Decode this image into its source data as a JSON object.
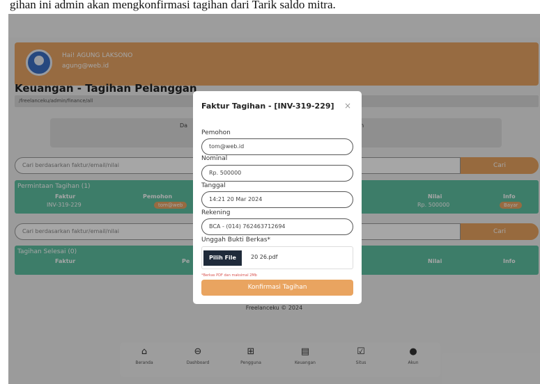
{
  "caption": "gihan ini admin akan mengkonfirmasi tagihan dari Tarik saldo mitra.",
  "profile": {
    "greeting": "Hai! AGUNG LAKSONO",
    "email": "agung@web.id"
  },
  "page": {
    "title": "Keuangan - Tagihan Pelanggan",
    "breadcrumb": "/freelanceku/admin/finance/all"
  },
  "stats": {
    "left_label": "Da",
    "right_label": "un"
  },
  "search": {
    "placeholder": "Cari berdasarkan faktur/email/nilai",
    "button": "Cari"
  },
  "requests": {
    "title": "Permintaan Tagihan (1)",
    "columns": [
      "Faktur",
      "Pemohon",
      "Nilai",
      "Info"
    ],
    "rows": [
      {
        "faktur": "INV-319-229",
        "pemohon": "tom@web",
        "nilai": "Rp. 500000",
        "info": "Bayar"
      }
    ]
  },
  "search2": {
    "placeholder": "Cari berdasarkan faktur/email/nilai",
    "button": "Cari"
  },
  "done": {
    "title": "Tagihan Selesai (0)",
    "columns": [
      "Faktur",
      "Pe",
      "Nilai",
      "Info"
    ]
  },
  "footer": "Freelanceku © 2024",
  "nav": [
    {
      "icon": "⌂",
      "label": "Beranda"
    },
    {
      "icon": "⊖",
      "label": "Dashboard"
    },
    {
      "icon": "⊞",
      "label": "Pengguna"
    },
    {
      "icon": "▤",
      "label": "Keuangan"
    },
    {
      "icon": "☑",
      "label": "Situs"
    },
    {
      "icon": "●",
      "label": "Akun"
    }
  ],
  "modal": {
    "title": "Faktur Tagihan - [INV-319-229]",
    "close": "×",
    "fields": [
      {
        "label": "Pemohon",
        "value": "tom@web.id"
      },
      {
        "label": "Nominal",
        "value": "Rp. 500000"
      },
      {
        "label": "Tanggal",
        "value": "14:21 20 Mar 2024"
      },
      {
        "label": "Rekening",
        "value": "BCA - (014) 762463712694"
      }
    ],
    "upload_label": "Unggah Bukti Berkas*",
    "upload_button": "Pilih File",
    "upload_filename": "20 26.pdf",
    "hint": "*Berkas PDF dan maksimal 2Mb",
    "confirm": "Konfirmasi Tagihan"
  },
  "colors": {
    "accent": "#e9a460",
    "panel": "#5fc1a2",
    "avatar": "#3b6fc4"
  }
}
